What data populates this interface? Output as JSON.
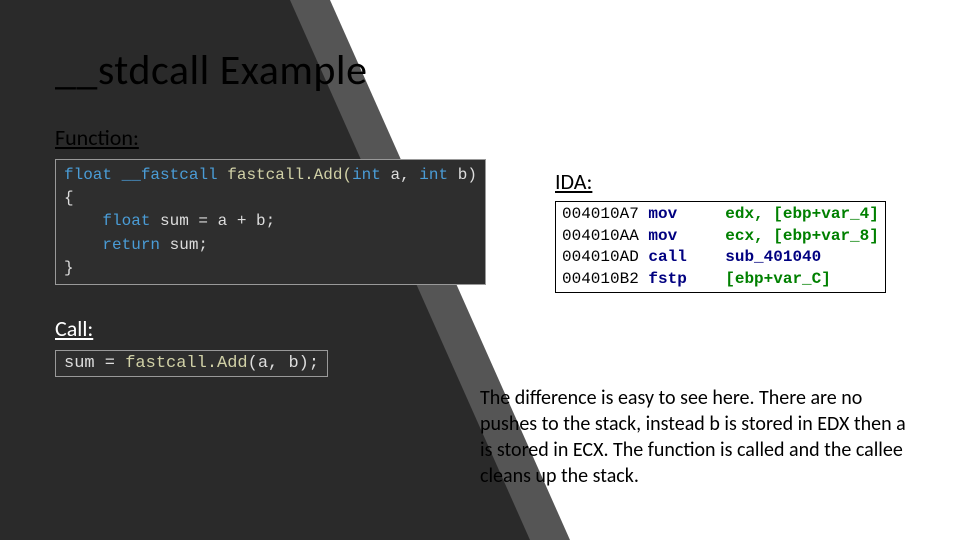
{
  "title": "__stdcall Example",
  "labels": {
    "function": "Function:",
    "call": "Call:",
    "ida": "IDA:"
  },
  "function_code": {
    "line1_kw1": "float",
    "line1_kw2": "__fastcall",
    "line1_fn": "fastcall.Add(",
    "line1_kw3": "int",
    "line1_p1": " a, ",
    "line1_kw4": "int",
    "line1_p2": " b)",
    "line2": "{",
    "line3_indent": "    ",
    "line3_kw": "float",
    "line3_rest": " sum = a + b;",
    "line4_indent": "    ",
    "line4_kw": "return",
    "line4_rest": " sum;",
    "line5": "}"
  },
  "call_code": {
    "lhs": "sum = ",
    "fn": "fastcall.Add",
    "args": "(a, b);"
  },
  "ida": {
    "rows": [
      {
        "addr": "004010A7",
        "mnem": "mov ",
        "ops": "    edx, [ebp+var_4]"
      },
      {
        "addr": "004010AA",
        "mnem": "mov ",
        "ops": "    ecx, [ebp+var_8]"
      },
      {
        "addr": "004010AD",
        "mnem": "call",
        "ops": "    sub_401040"
      },
      {
        "addr": "004010B2",
        "mnem": "fstp",
        "ops": "    [ebp+var_C]"
      }
    ]
  },
  "body": "The difference is easy to see here.  There are no pushes to the stack, instead b is stored in EDX then a is stored in ECX.  The function is called and the callee cleans up the stack."
}
